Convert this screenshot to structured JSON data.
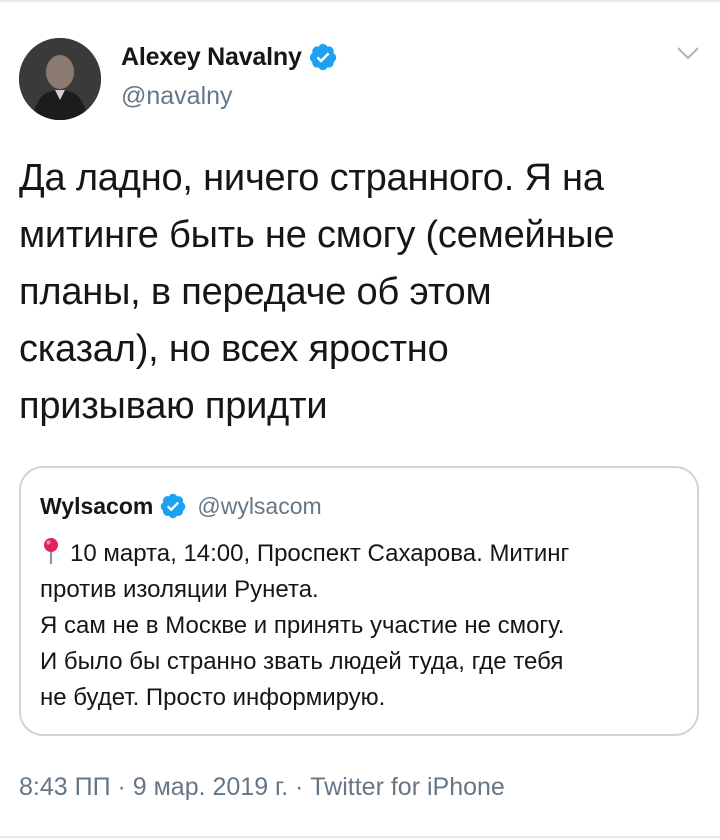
{
  "tweet": {
    "author": {
      "display_name": "Alexey Navalny",
      "handle": "@navalny",
      "verified": true
    },
    "text_lines": [
      "Да ладно, ничего странного. Я на",
      "митинге быть не смогу (семейные",
      "планы, в передаче об этом",
      "сказал), но всех яростно",
      "призываю придти"
    ],
    "quoted": {
      "display_name": "Wylsacom",
      "handle": "@wylsacom",
      "verified": true,
      "lines": [
        "10 марта, 14:00, Проспект Сахарова. Митинг",
        "против изоляции Рунета.",
        "Я сам не в Москве и принять участие не смогу.",
        "И было бы странно звать людей туда, где тебя",
        "не будет. Просто информирую."
      ]
    },
    "meta": "8:43 ПП · 9 мар. 2019 г. · Twitter for iPhone"
  },
  "colors": {
    "text": "#14171a",
    "secondary": "#657786",
    "verified": "#1da1f2",
    "border": "#ccd6dd",
    "pin": "#e0245e"
  },
  "icons": {
    "verified": "verified-badge-icon",
    "more": "chevron-down-icon",
    "pin": "round-pushpin-icon"
  }
}
